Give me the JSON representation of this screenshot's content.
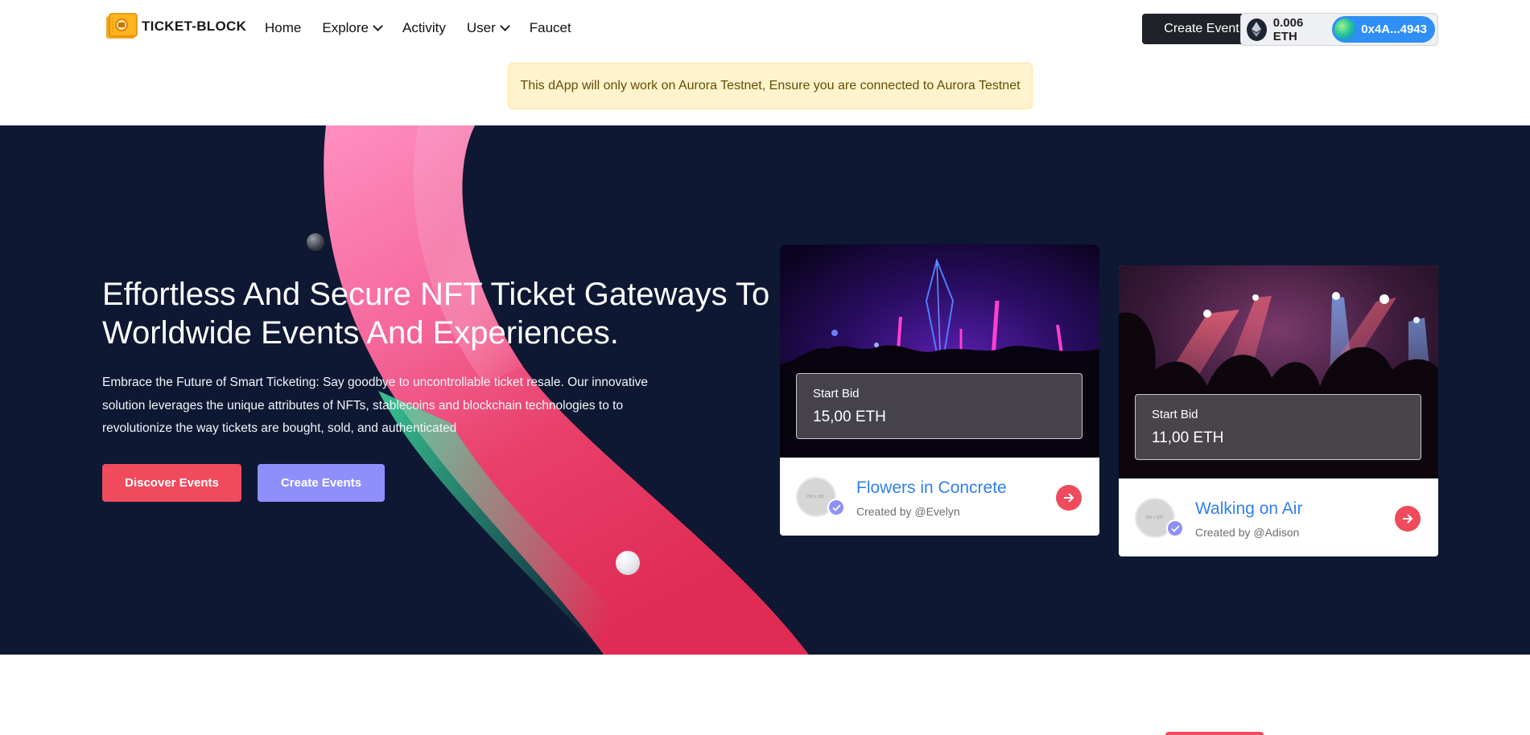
{
  "brand": {
    "name": "TICKET-BLOCK"
  },
  "nav": {
    "items": [
      {
        "label": "Home",
        "has_dropdown": false
      },
      {
        "label": "Explore",
        "has_dropdown": true
      },
      {
        "label": "Activity",
        "has_dropdown": false
      },
      {
        "label": "User",
        "has_dropdown": true
      },
      {
        "label": "Faucet",
        "has_dropdown": false
      }
    ]
  },
  "header": {
    "create_event_label": "Create Event",
    "wallet": {
      "balance": "0.006 ETH",
      "address": "0x4A...4943"
    }
  },
  "alert": {
    "text": "This dApp will only work on Aurora Testnet, Ensure you are connected to Aurora Testnet"
  },
  "hero": {
    "title": "Effortless And Secure NFT Ticket Gateways To Worldwide Events And Experiences.",
    "description": "Embrace the Future of Smart Ticketing: Say goodbye to uncontrollable ticket resale. Our innovative solution leverages the unique attributes of NFTs, stablecoins and blockchain technologies to to revolutionize the way tickets are bought, sold, and authenticated",
    "discover_label": "Discover Events",
    "create_label": "Create Events"
  },
  "cards": [
    {
      "bid_label": "Start Bid",
      "bid_value": "15,00 ETH",
      "title": "Flowers in Concrete",
      "creator": "Created by @Evelyn",
      "avatar_placeholder": "200 x 200"
    },
    {
      "bid_label": "Start Bid",
      "bid_value": "11,00 ETH",
      "title": "Walking on Air",
      "creator": "Created by @Adison",
      "avatar_placeholder": "200 x 200"
    }
  ],
  "colors": {
    "hero_bg": "#0e1833",
    "accent_red": "#ef4b5d",
    "accent_purple": "#8f8ffb",
    "link_blue": "#2f80ed",
    "alert_bg": "#fff3cd"
  }
}
